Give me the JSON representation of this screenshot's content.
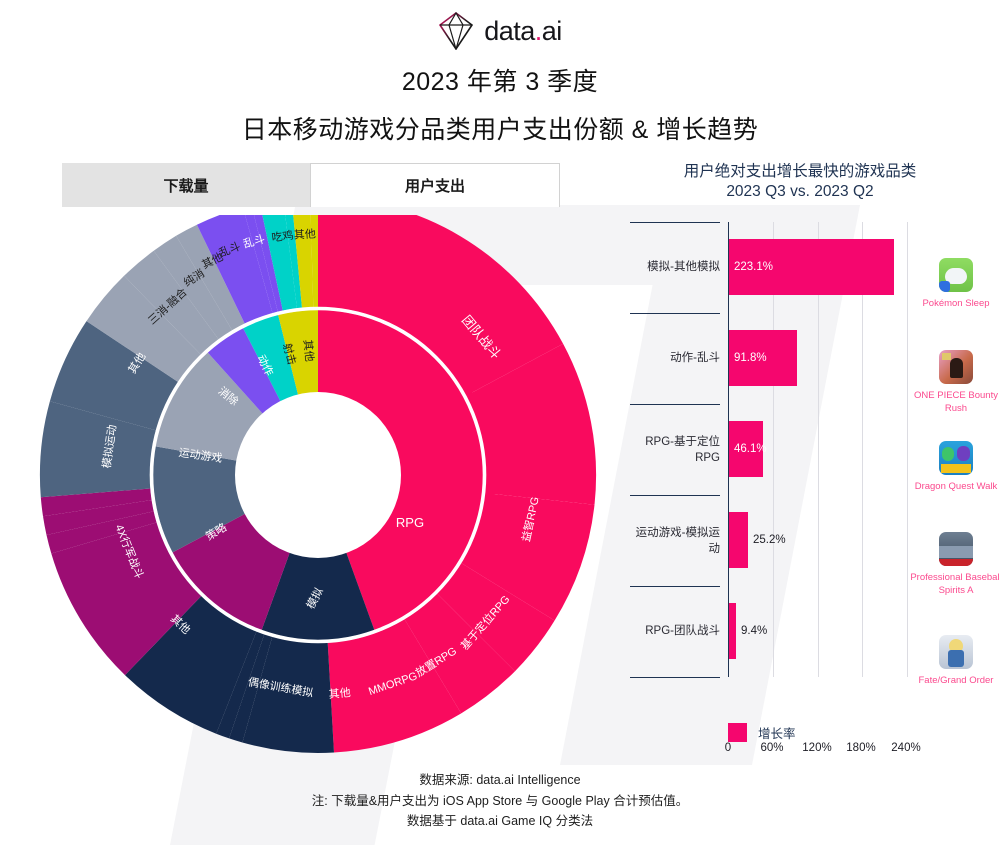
{
  "brand": {
    "name": "data.ai",
    "logo_icon": "diamond-logo-icon",
    "accent": "#e4136b"
  },
  "header": {
    "title_line1": "2023 年第 3 季度",
    "title_line2": "日本移动游戏分品类用户支出份额 & 增长趋势"
  },
  "tabs": [
    {
      "id": "downloads",
      "label": "下载量",
      "active": false
    },
    {
      "id": "consumer-spend",
      "label": "用户支出",
      "active": true
    }
  ],
  "sunburst": {
    "inner_ring": [
      {
        "label": "RPG",
        "value": 44.5,
        "color": "#F90A5E"
      },
      {
        "label": "益智RPG",
        "value": 0,
        "color": "#F90A5E"
      },
      {
        "label": "其他",
        "value": 14.0,
        "color": "#0F2547"
      },
      {
        "label": "模拟",
        "value": 11.0,
        "color": "#14294C"
      },
      {
        "label": "策略",
        "value": 10.5,
        "color": "#9C0D73"
      },
      {
        "label": "运动游戏",
        "value": 7.5,
        "color": "#4E6480"
      },
      {
        "label": "消除",
        "value": 6.5,
        "color": "#9AA3B4"
      },
      {
        "label": "动作",
        "value": 4.0,
        "color": "#7B4FF0"
      },
      {
        "label": "射击",
        "value": 2.0,
        "color": "#00D2C8"
      },
      {
        "label": "其他",
        "value": 3.5,
        "color": "#D9D400"
      }
    ],
    "outer_ring": [
      {
        "label": "团队战斗",
        "parent": "RPG",
        "color": "#F90A5E"
      },
      {
        "label": "益智RPG",
        "parent": "RPG",
        "color": "#F90A5E"
      },
      {
        "label": "基于定位RPG",
        "parent": "RPG",
        "color": "#F90A5E"
      },
      {
        "label": "放置RPG",
        "parent": "RPG",
        "color": "#F90A5E"
      },
      {
        "label": "MMORPG",
        "parent": "RPG",
        "color": "#F90A5E"
      },
      {
        "label": "其他",
        "parent": "RPG",
        "color": "#F90A5E"
      },
      {
        "label": "偶像训练模拟",
        "parent": "模拟",
        "color": "#14294C"
      },
      {
        "label": "其他",
        "parent": "模拟",
        "color": "#14294C"
      },
      {
        "label": "4X行军战斗",
        "parent": "策略",
        "color": "#9C0D73"
      },
      {
        "label": "模拟运动",
        "parent": "运动游戏",
        "color": "#4E6480"
      },
      {
        "label": "其他",
        "parent": "运动游戏",
        "color": "#4E6480"
      },
      {
        "label": "三消-融合",
        "parent": "消除",
        "color": "#9AA3B4"
      },
      {
        "label": "纯消",
        "parent": "消除",
        "color": "#9AA3B4"
      },
      {
        "label": "其他",
        "parent": "消除",
        "color": "#9AA3B4"
      },
      {
        "label": "乱斗",
        "parent": "动作",
        "color": "#7B4FF0"
      },
      {
        "label": "吃鸡",
        "parent": "射击",
        "color": "#00D2C8"
      },
      {
        "label": "其他",
        "parent": "其他",
        "color": "#D9D400"
      }
    ]
  },
  "right_panel": {
    "title": "用户绝对支出增长最快的游戏品类",
    "subtitle": "2023 Q3 vs. 2023 Q2",
    "legend_label": "增长率",
    "legend_color": "#f5066e"
  },
  "chart_data": {
    "type": "bar",
    "title": "用户绝对支出增长最快的游戏品类",
    "subtitle": "2023 Q3 vs. 2023 Q2",
    "orientation": "horizontal",
    "categories": [
      "模拟-其他模拟",
      "动作-乱斗",
      "RPG-基于定位RPG",
      "运动游戏-模拟运动",
      "RPG-团队战斗"
    ],
    "values": [
      223.1,
      91.8,
      46.1,
      25.2,
      9.4
    ],
    "value_labels": [
      "223.1%",
      "91.8%",
      "46.1%",
      "25.2%",
      "9.4%"
    ],
    "series": [
      {
        "name": "增长率",
        "values": [
          223.1,
          91.8,
          46.1,
          25.2,
          9.4
        ]
      }
    ],
    "xlabel": "",
    "ylabel": "",
    "xlim": [
      0,
      270
    ],
    "xticks": [
      0,
      60,
      120,
      180,
      240
    ],
    "xtick_labels": [
      "0",
      "60%",
      "120%",
      "180%",
      "240%"
    ],
    "grid": true,
    "legend_position": "bottom",
    "bar_color": "#f5066e",
    "apps": [
      {
        "name": "Pokémon Sleep",
        "icon": "pokemon-sleep-icon"
      },
      {
        "name": "ONE PIECE Bounty Rush",
        "icon": "one-piece-bounty-rush-icon"
      },
      {
        "name": "Dragon Quest Walk",
        "icon": "dragon-quest-walk-icon"
      },
      {
        "name": "Professional Baseball Spirits A",
        "icon": "professional-baseball-spirits-a-icon"
      },
      {
        "name": "Fate/Grand Order",
        "icon": "fate-grand-order-icon"
      }
    ]
  },
  "footer": {
    "line1": "数据来源: data.ai Intelligence",
    "line2": "注: 下载量&用户支出为 iOS App Store 与 Google Play 合计预估值。",
    "line3": "数据基于 data.ai Game IQ 分类法"
  }
}
